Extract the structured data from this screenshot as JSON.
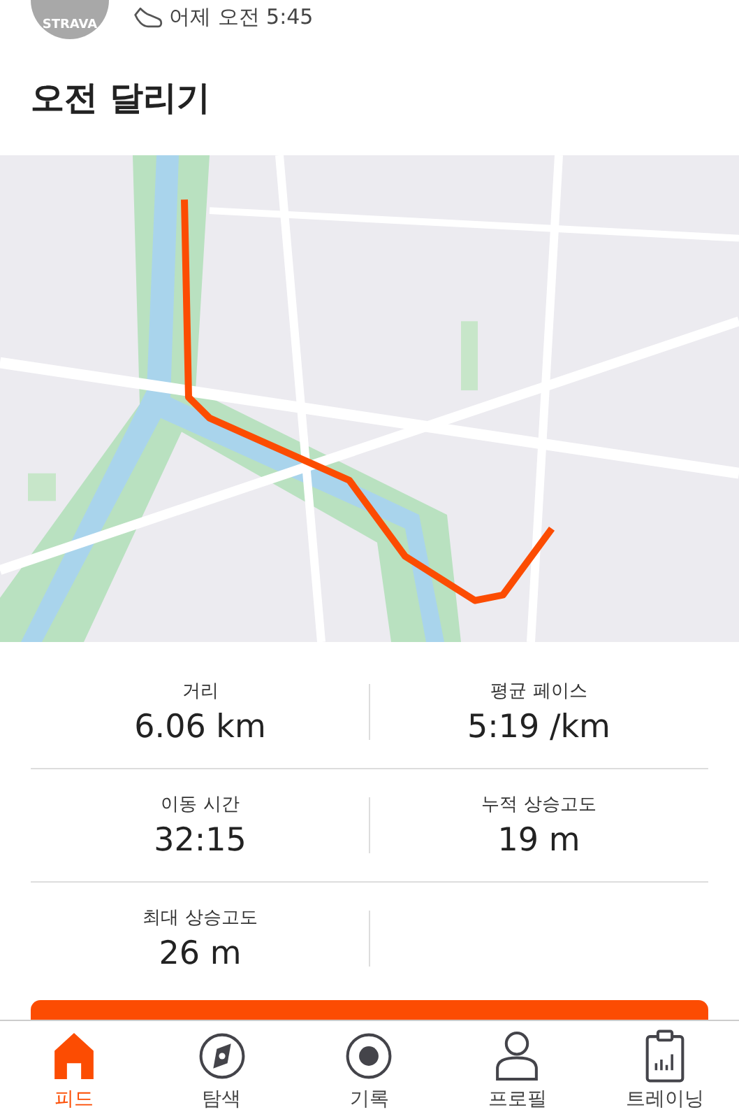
{
  "header": {
    "avatar_label": "STRAVA",
    "timestamp": "어제 오전 5:45"
  },
  "title": "오전 달리기",
  "stats": [
    {
      "label": "거리",
      "value": "6.06 km"
    },
    {
      "label": "평균 페이스",
      "value": "5:19 /km"
    },
    {
      "label": "이동 시간",
      "value": "32:15"
    },
    {
      "label": "누적 상승고도",
      "value": "19 m"
    },
    {
      "label": "최대 상승고도",
      "value": "26 m"
    }
  ],
  "nav": [
    {
      "label": "피드",
      "selected": true
    },
    {
      "label": "탐색",
      "selected": false
    },
    {
      "label": "기록",
      "selected": false
    },
    {
      "label": "프로필",
      "selected": false
    },
    {
      "label": "트레이닝",
      "selected": false
    }
  ]
}
